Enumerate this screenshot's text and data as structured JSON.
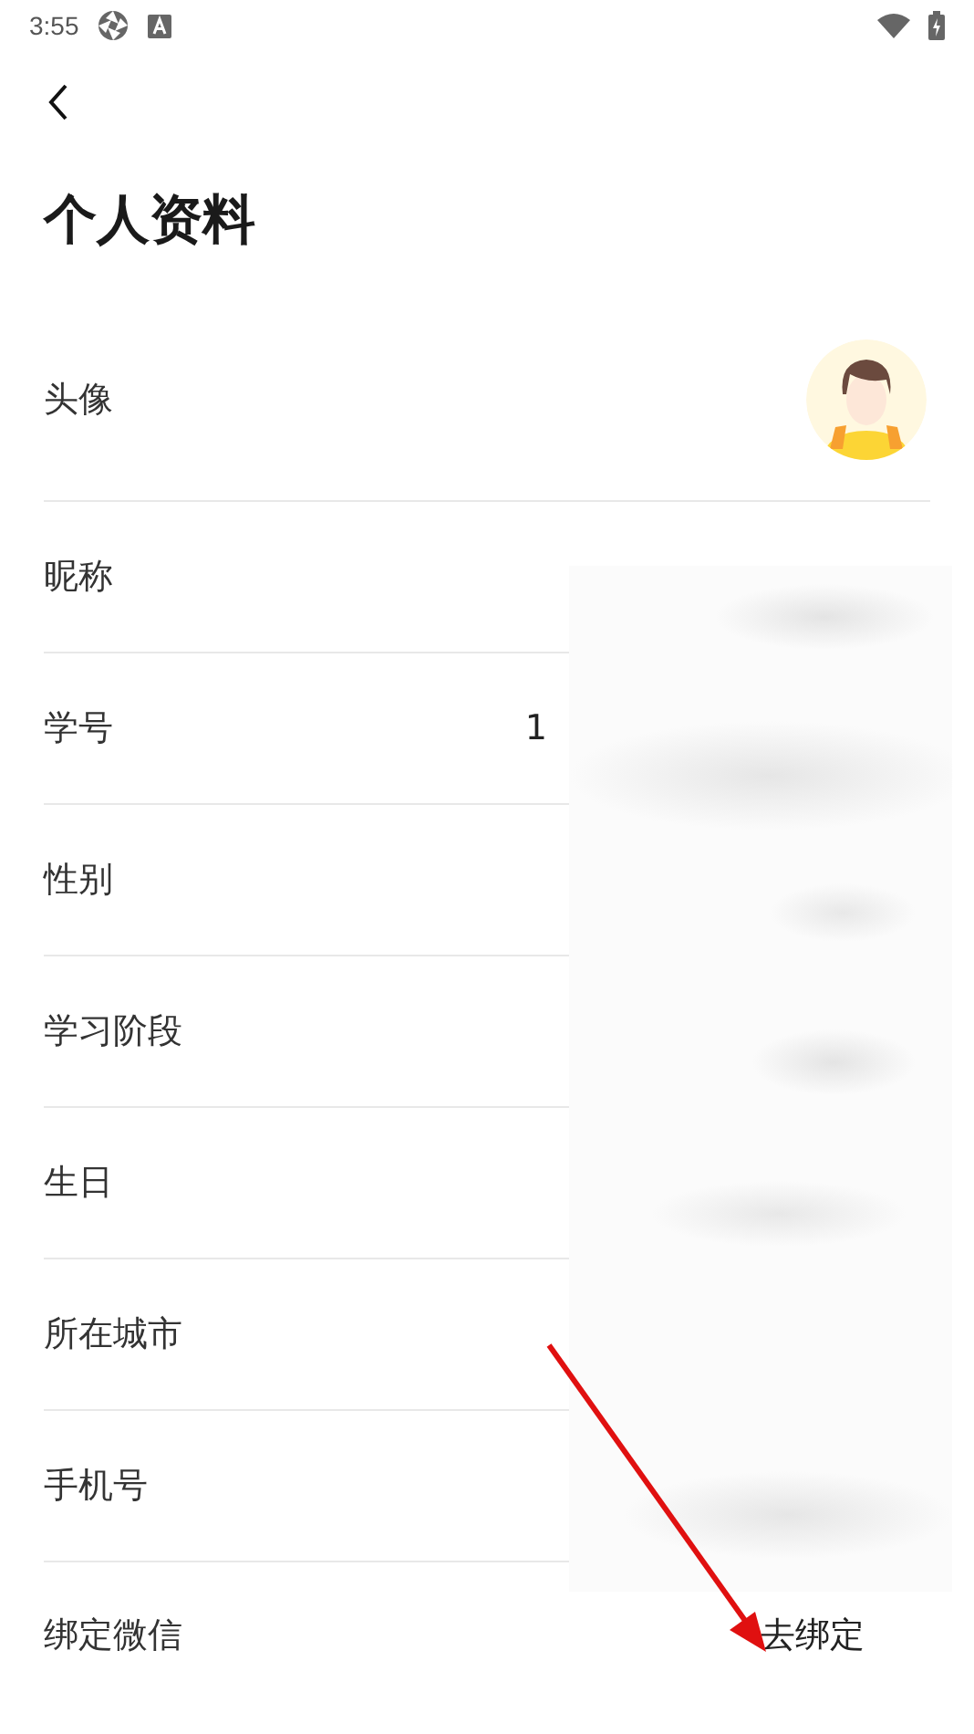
{
  "status_bar": {
    "time": "3:55"
  },
  "title": "个人资料",
  "rows": [
    {
      "kind": "avatar",
      "label": "头像"
    },
    {
      "kind": "text",
      "label": "昵称"
    },
    {
      "kind": "text",
      "label": "学号",
      "value": "1"
    },
    {
      "kind": "text",
      "label": "性别"
    },
    {
      "kind": "text",
      "label": "学习阶段"
    },
    {
      "kind": "text",
      "label": "生日"
    },
    {
      "kind": "text",
      "label": "所在城市"
    },
    {
      "kind": "text",
      "label": "手机号"
    },
    {
      "kind": "action",
      "label": "绑定微信",
      "value": "去绑定"
    }
  ],
  "value_blur": true,
  "annotation": {
    "kind": "arrow"
  }
}
